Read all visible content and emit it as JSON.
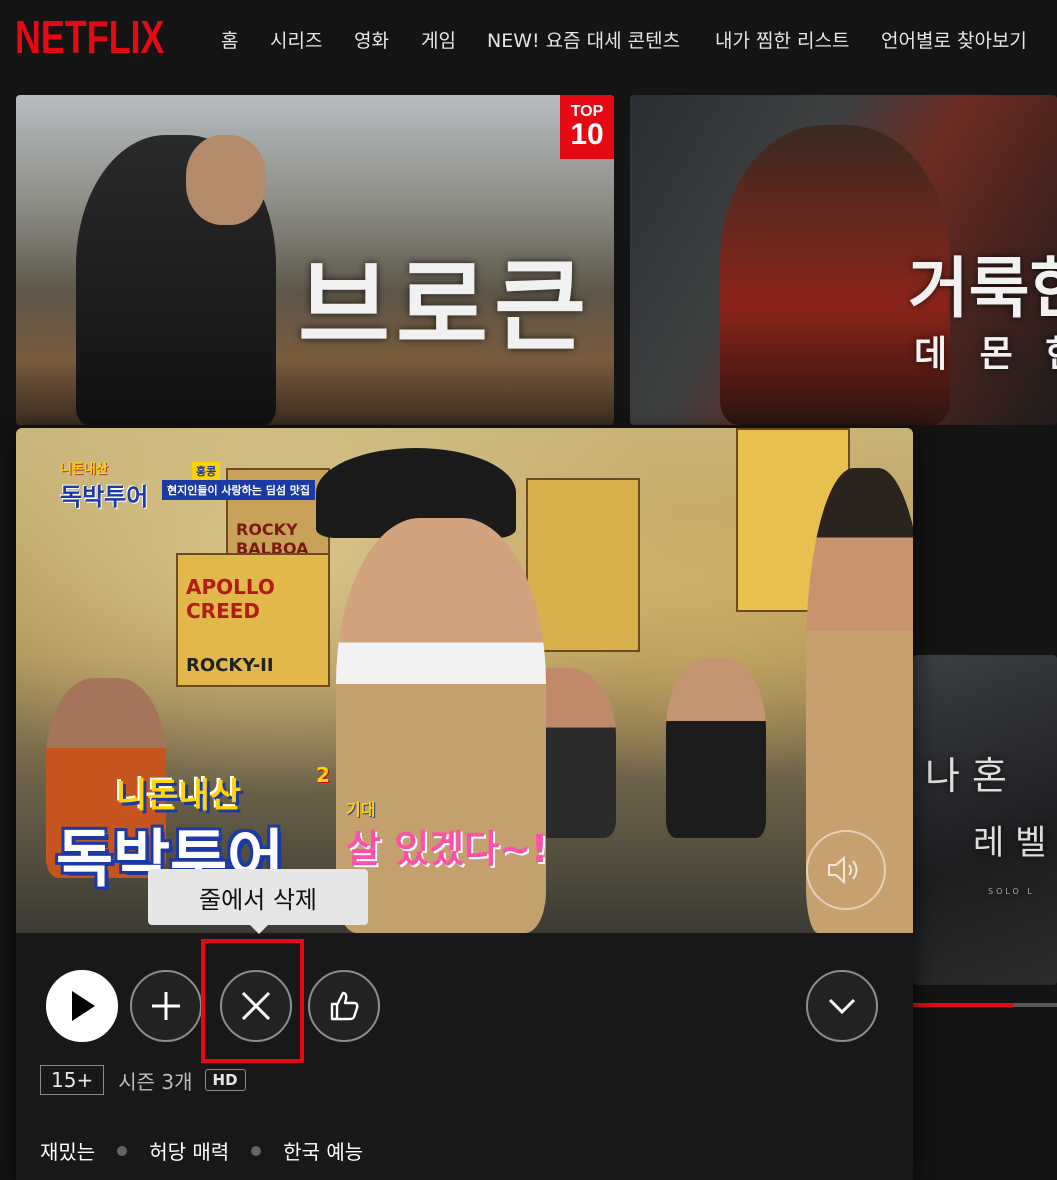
{
  "brand": {
    "logo": "NETFLIX",
    "accent": "#e50914"
  },
  "nav": {
    "items": [
      "홈",
      "시리즈",
      "영화",
      "게임",
      "NEW! 요즘 대세 콘텐츠",
      "내가 찜한 리스트",
      "언어별로 찾아보기"
    ]
  },
  "row": {
    "cards": [
      {
        "title": "브로큰",
        "badge_top": "TOP",
        "badge_num": "10"
      },
      {
        "title": "거룩한",
        "subtitle": "데 몬 헌"
      }
    ],
    "peek_card": {
      "title_chars": "나 혼",
      "sub_chars": "레 벨",
      "tiny": "SOLO L",
      "progress": 0.7
    }
  },
  "preview": {
    "show_logo_top": "니돈내산",
    "show_logo_bottom": "독박투어",
    "episode_tag": "홍콩",
    "episode_caption": "현지인들이 사랑하는 딤섬 맛집",
    "overlay_logo_top": "니돈내산",
    "overlay_logo_bottom": "독박투어",
    "overlay_number": "2",
    "overlay_suffix": "기대",
    "overlay_speech": "살 있겠다~!",
    "posters": [
      "ROCKY BALBOA",
      "APOLLO CREED",
      "ROCKY-II"
    ],
    "tooltip": "줄에서 삭제",
    "rating": "15+",
    "seasons": "시즌 3개",
    "quality": "HD",
    "tags": [
      "재밌는",
      "허당 매력",
      "한국 예능"
    ]
  }
}
